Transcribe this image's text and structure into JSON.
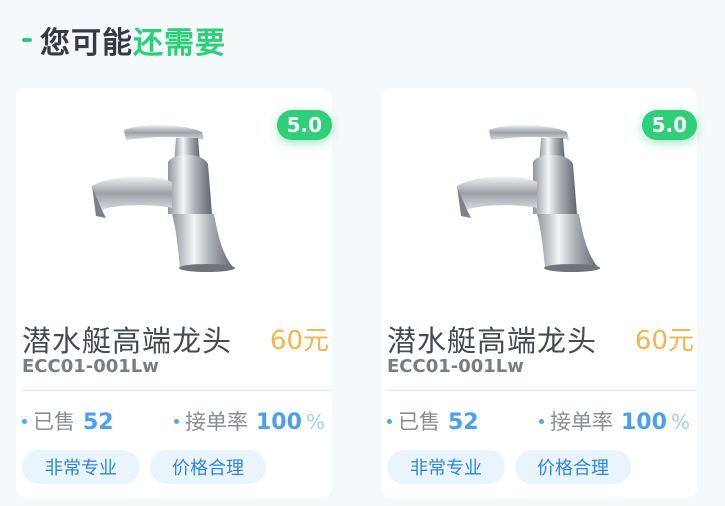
{
  "section": {
    "title_dark": "您可能",
    "title_accent": "还需要"
  },
  "products": [
    {
      "rating": "5.0",
      "name": "潜水艇高端龙头",
      "price": "60元",
      "code": "ECC01-001Lw",
      "sold_label": "已售",
      "sold_value": "52",
      "rate_label": "接单率",
      "rate_value": "100",
      "rate_unit": "%",
      "tags": [
        "非常专业",
        "价格合理"
      ]
    },
    {
      "rating": "5.0",
      "name": "潜水艇高端龙头",
      "price": "60元",
      "code": "ECC01-001Lw",
      "sold_label": "已售",
      "sold_value": "52",
      "rate_label": "接单率",
      "rate_value": "100",
      "rate_unit": "%",
      "tags": [
        "非常专业",
        "价格合理"
      ]
    }
  ],
  "colors": {
    "accent": "#2ecf78",
    "price": "#f5b451",
    "stat": "#4a9ff0"
  },
  "icons": {
    "product_image": "faucet-icon",
    "bullet": "dot-icon"
  }
}
